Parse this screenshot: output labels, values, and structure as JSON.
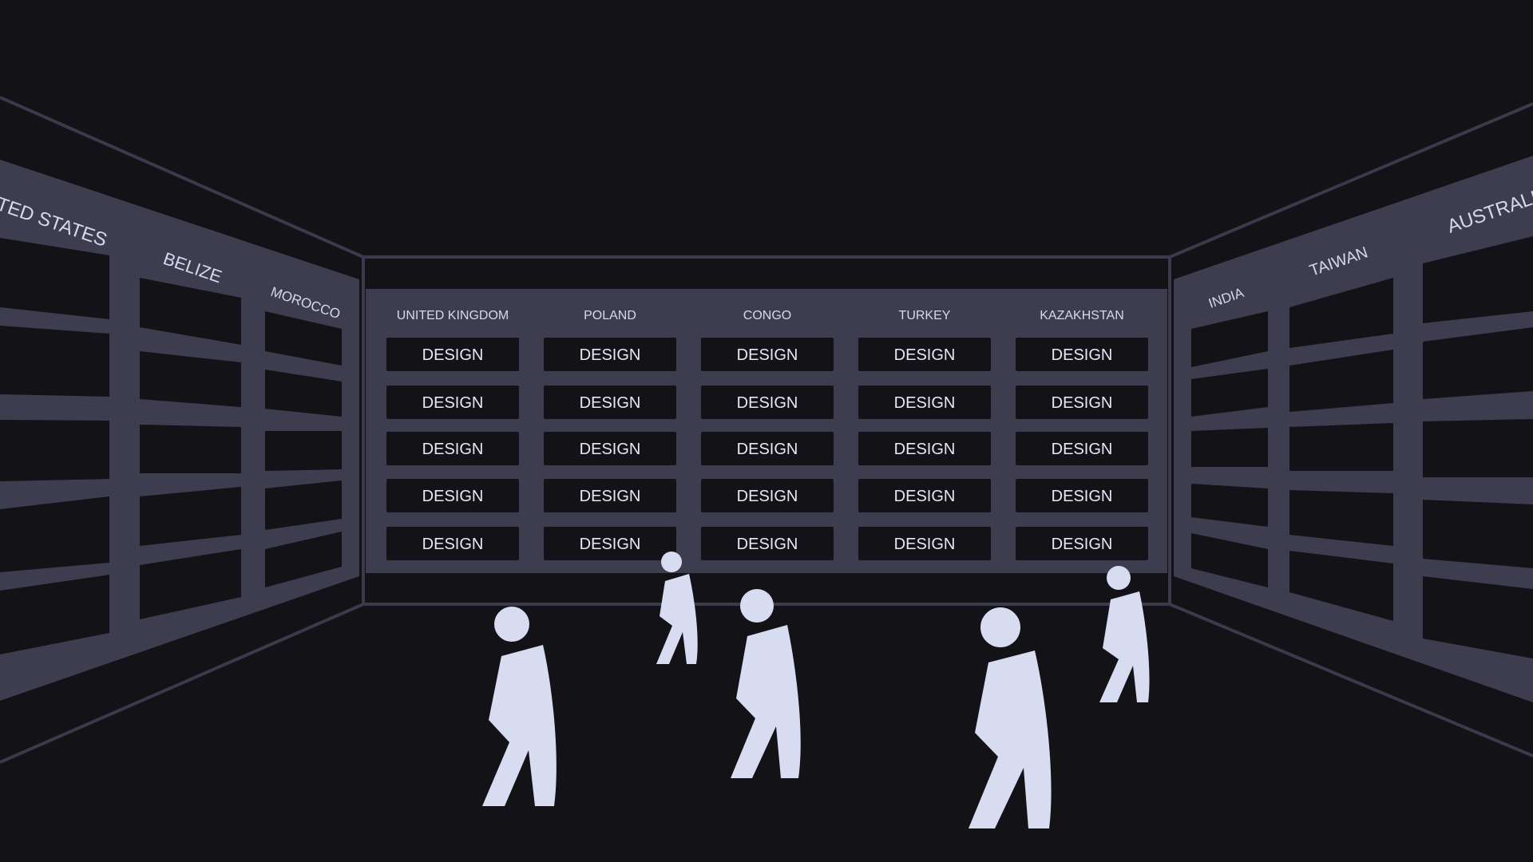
{
  "colors": {
    "background": "#121217",
    "panel": "#3d3d4f",
    "line": "#3a3a4c",
    "cell": "#121217",
    "text": "#e6e8f6",
    "figure": "#d8dcf0"
  },
  "center_wall": {
    "countries": [
      "UNITED KINGDOM",
      "POLAND",
      "CONGO",
      "TURKEY",
      "KAZAKHSTAN"
    ],
    "cell_label": "DESIGN",
    "rows": 5
  },
  "left_wall": {
    "countries": [
      "TED STATES",
      "BELIZE",
      "MOROCCO"
    ]
  },
  "right_wall": {
    "countries": [
      "INDIA",
      "TAIWAN",
      "AUSTRALI"
    ]
  },
  "figures": [
    {
      "name": "person-1"
    },
    {
      "name": "person-2"
    },
    {
      "name": "person-3"
    },
    {
      "name": "person-4"
    },
    {
      "name": "person-5"
    }
  ]
}
